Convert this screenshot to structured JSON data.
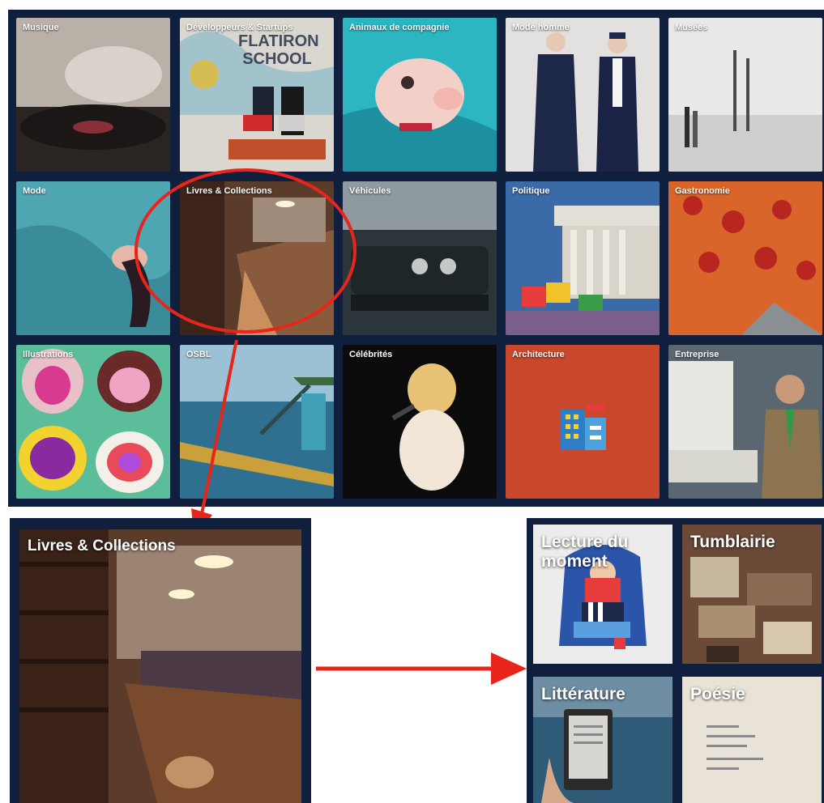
{
  "grid": {
    "tiles": [
      {
        "label": "Musique"
      },
      {
        "label": "Développeurs & Startups"
      },
      {
        "label": "Animaux de compagnie"
      },
      {
        "label": "Mode homme"
      },
      {
        "label": "Musées"
      },
      {
        "label": "Mode"
      },
      {
        "label": "Livres & Collections"
      },
      {
        "label": "Véhicules"
      },
      {
        "label": "Politique"
      },
      {
        "label": "Gastronomie"
      },
      {
        "label": "Illustrations"
      },
      {
        "label": "OSBL"
      },
      {
        "label": "Célébrités"
      },
      {
        "label": "Architecture"
      },
      {
        "label": "Entreprise"
      }
    ],
    "tile_signs": {
      "school_sign": "FLATIRON SCHOOL"
    }
  },
  "detail": {
    "label": "Livres & Collections"
  },
  "subcategories": [
    {
      "label": "Lecture du moment"
    },
    {
      "label": "Tumblairie"
    },
    {
      "label": "Littérature"
    },
    {
      "label": "Poésie"
    }
  ],
  "colors": {
    "grid_bg": "#0f1f3d",
    "highlight": "#e8251b",
    "arrow": "#e8251b",
    "architecture_tile": "#c9472a"
  }
}
